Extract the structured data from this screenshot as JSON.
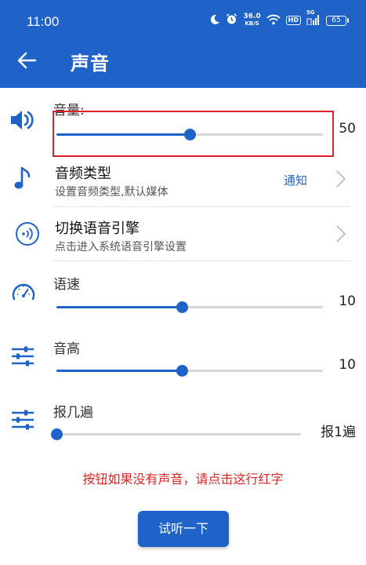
{
  "status_bar": {
    "time": "11:00",
    "net_speed_value": "36.0",
    "net_speed_unit": "KB/S",
    "hd_badge": "HD",
    "signal_label": "5G",
    "battery": "65"
  },
  "header": {
    "title": "声音"
  },
  "volume": {
    "label": "音量:",
    "value": "50",
    "level_fraction": 0.5
  },
  "audio_type": {
    "title": "音频类型",
    "subtitle": "设置音频类型,默认媒体",
    "current": "通知"
  },
  "tts_engine": {
    "title": "切换语音引擎",
    "subtitle": "点击进入系统语音引擎设置"
  },
  "speech_rate": {
    "label": "语速",
    "value": "10",
    "level_fraction": 0.47
  },
  "pitch": {
    "label": "音高",
    "value": "10",
    "level_fraction": 0.47
  },
  "repeat": {
    "label": "报几遍",
    "value": "报1遍",
    "level_fraction": 0.0
  },
  "warning_text": "按钮如果没有声音，请点击这行红字",
  "test_button": "试听一下",
  "colors": {
    "accent": "#1f63c8",
    "warning": "#e02424",
    "highlight_border": "#e0202a"
  }
}
